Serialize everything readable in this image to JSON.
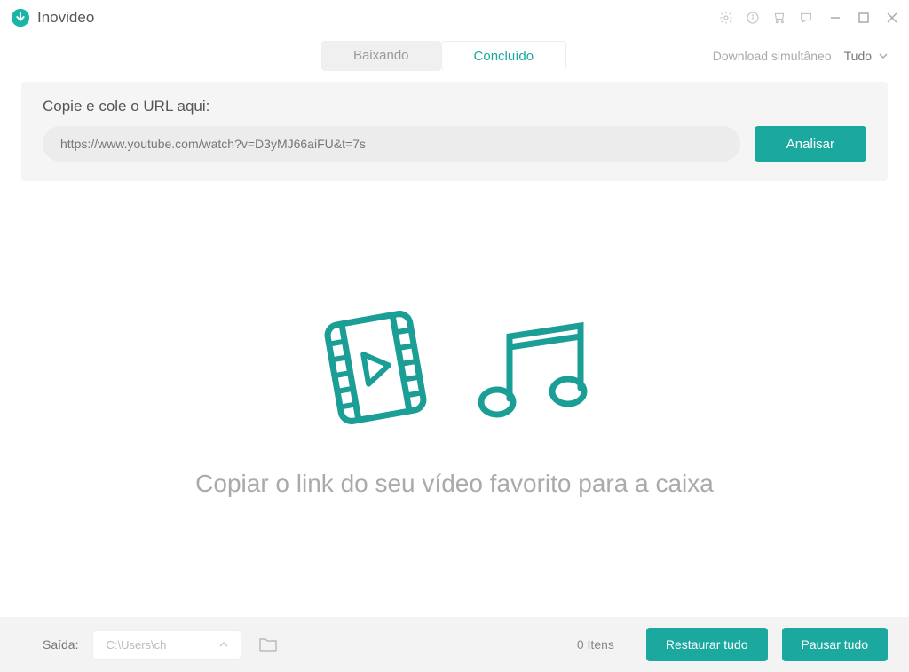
{
  "app": {
    "title": "Inovideo"
  },
  "tabs": {
    "downloading": "Baixando",
    "completed": "Concluído"
  },
  "simultaneous": {
    "label": "Download simultâneo",
    "value": "Tudo"
  },
  "urlSection": {
    "label": "Copie e cole o URL aqui:",
    "value": "https://www.youtube.com/watch?v=D3yMJ66aiFU&t=7s",
    "analyze": "Analisar"
  },
  "empty": {
    "text": "Copiar o link do seu vídeo favorito para a caixa"
  },
  "footer": {
    "outputLabel": "Saída:",
    "outputPath": "C:\\Users\\ch",
    "itemsCount": "0 Itens",
    "restoreAll": "Restaurar tudo",
    "pauseAll": "Pausar tudo"
  }
}
